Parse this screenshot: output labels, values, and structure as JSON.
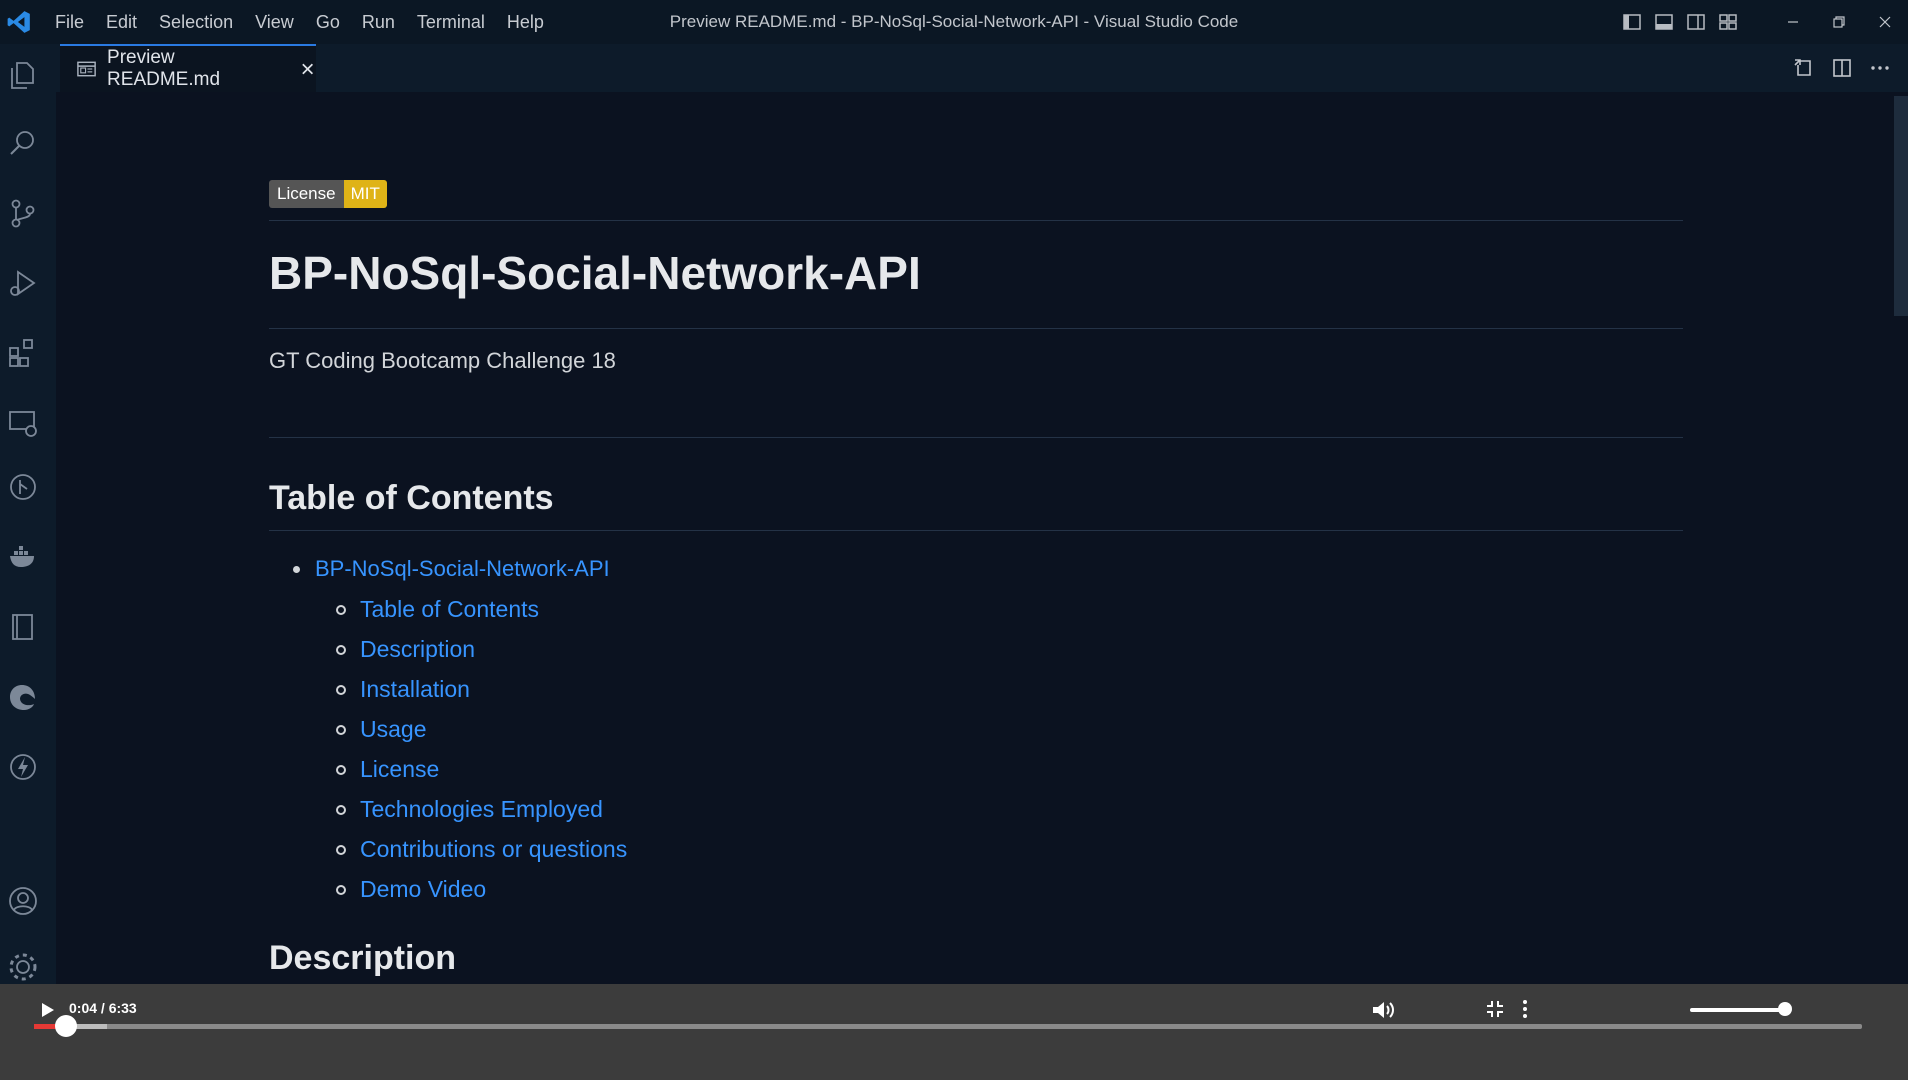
{
  "window": {
    "title": "Preview README.md - BP-NoSql-Social-Network-API - Visual Studio Code"
  },
  "menu": [
    "File",
    "Edit",
    "Selection",
    "View",
    "Go",
    "Run",
    "Terminal",
    "Help"
  ],
  "tab": {
    "label": "Preview README.md",
    "icon": "preview-icon"
  },
  "activity_icons": [
    "explorer-icon",
    "search-icon",
    "source-control-icon",
    "run-debug-icon",
    "extensions-icon",
    "remote-explorer-icon",
    "git-graph-icon",
    "docker-icon",
    "notebook-icon",
    "edge-devtools-icon",
    "thunder-client-icon",
    "accounts-icon",
    "settings-gear-icon"
  ],
  "readme": {
    "badge": {
      "label": "License",
      "value": "MIT",
      "value_color": "#dfb317"
    },
    "title": "BP-NoSql-Social-Network-API",
    "subtitle": "GT Coding Bootcamp Challenge 18",
    "toc_heading": "Table of Contents",
    "toc_top": "BP-NoSql-Social-Network-API",
    "toc_items": [
      "Table of Contents",
      "Description",
      "Installation",
      "Usage",
      "License",
      "Technologies Employed",
      "Contributions or questions",
      "Demo Video"
    ],
    "next_heading": "Description"
  },
  "player": {
    "time": "0:04 / 6:33",
    "progress_played": 0.0175,
    "progress_buffered": 0.04,
    "volume": 1.0
  },
  "colors": {
    "link": "#3794ff",
    "accent": "#2a7ae2",
    "progress": "#e53935"
  }
}
